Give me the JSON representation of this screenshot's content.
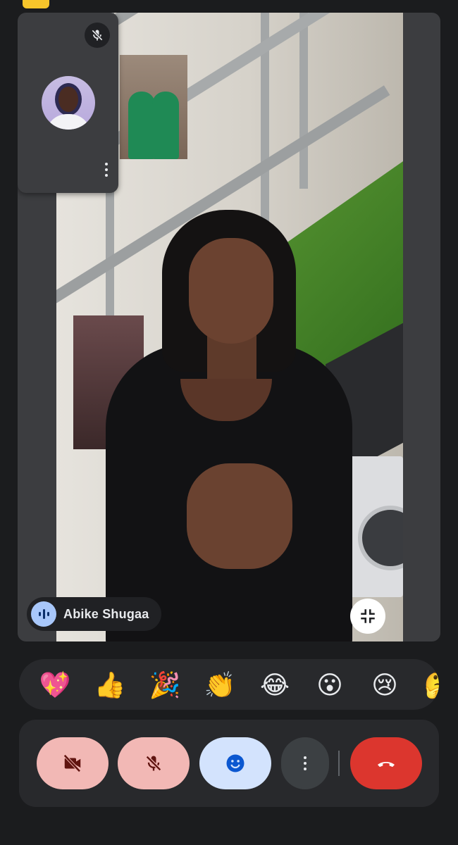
{
  "participant": {
    "name": "Abike Shugaa",
    "speaking": true
  },
  "self_view": {
    "muted": true
  },
  "reactions": [
    {
      "id": "sparkling-heart",
      "glyph": "💖"
    },
    {
      "id": "thumbs-up",
      "glyph": "👍"
    },
    {
      "id": "party-popper",
      "glyph": "🎉"
    },
    {
      "id": "clapping-hands",
      "glyph": "👏"
    },
    {
      "id": "tears-of-joy",
      "glyph": "😂"
    },
    {
      "id": "surprised",
      "glyph": "😮"
    },
    {
      "id": "crying",
      "glyph": "😢"
    },
    {
      "id": "thinking",
      "glyph": "🤔"
    }
  ],
  "controls": {
    "camera": {
      "state": "off",
      "icon": "camera-off-icon"
    },
    "mic": {
      "state": "off",
      "icon": "mic-off-icon"
    },
    "reactions": {
      "state": "active",
      "icon": "emoji-icon"
    },
    "more": {
      "icon": "more-vert-icon"
    },
    "leave": {
      "icon": "call-end-icon"
    }
  },
  "colors": {
    "off_button_bg": "#f2b8b5",
    "off_icon": "#601410",
    "reactions_active_bg": "#d3e3fd",
    "reactions_icon": "#0b57d0",
    "leave_bg": "#dc362e",
    "more_bg": "#3c4043",
    "speaking_bg": "#a8c7fa",
    "page_bg": "#1b1c1e"
  }
}
